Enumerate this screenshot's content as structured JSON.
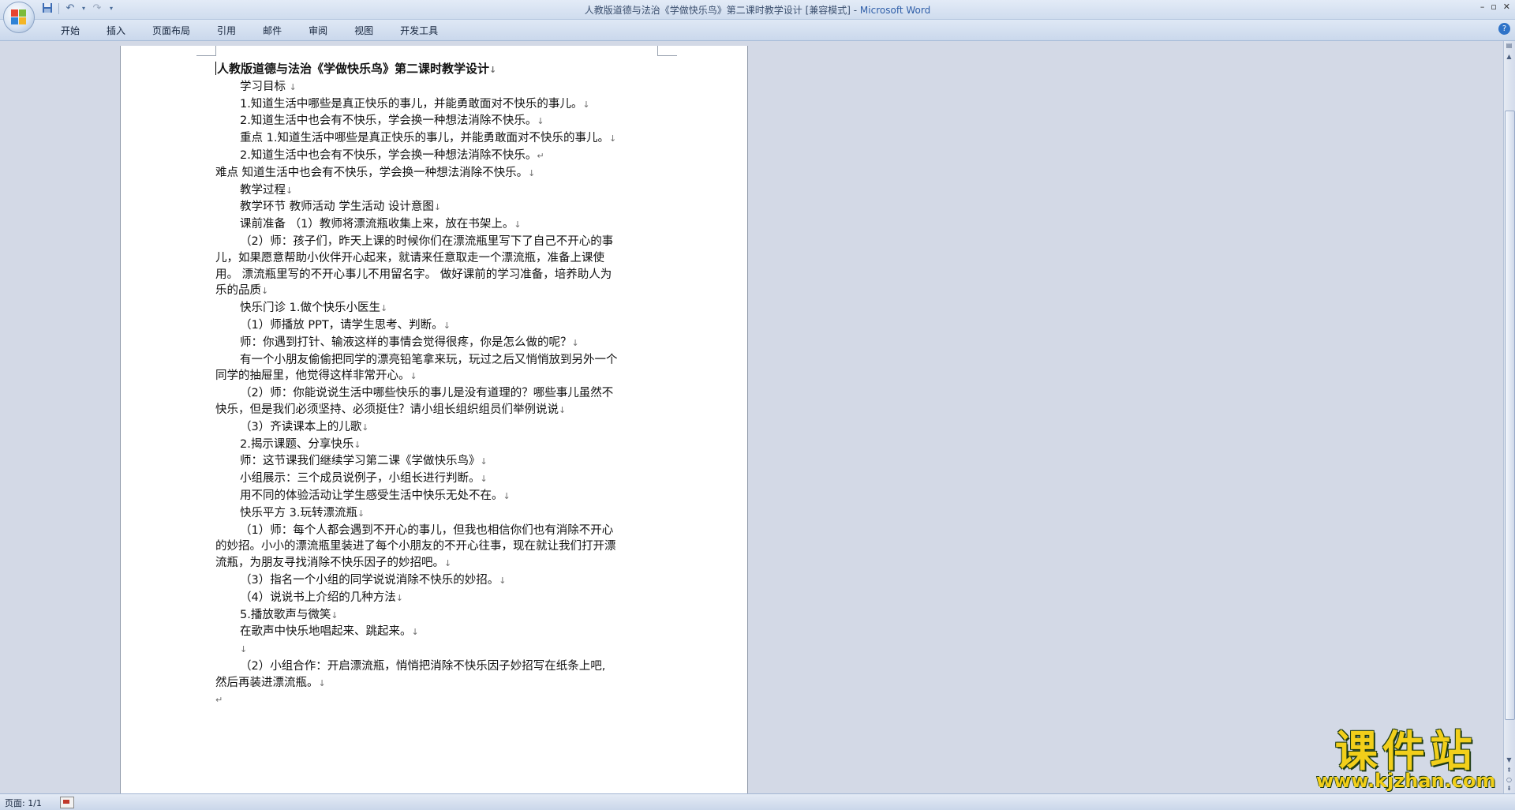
{
  "window": {
    "doc_name": "人教版道德与法治《学做快乐鸟》第二课时教学设计 [兼容模式] - ",
    "app_name": "Microsoft Word"
  },
  "ribbon": {
    "tabs": [
      "开始",
      "插入",
      "页面布局",
      "引用",
      "邮件",
      "审阅",
      "视图",
      "开发工具"
    ]
  },
  "document": {
    "title": "人教版道德与法治《学做快乐鸟》第二课时教学设计",
    "lines": [
      {
        "text": "学习目标 ",
        "indent": true
      },
      {
        "text": "1.知道生活中哪些是真正快乐的事儿，并能勇敢面对不快乐的事儿。",
        "indent": true
      },
      {
        "text": "2.知道生活中也会有不快乐，学会换一种想法消除不快乐。",
        "indent": true
      },
      {
        "text": "重点 1.知道生活中哪些是真正快乐的事儿，并能勇敢面对不快乐的事儿。",
        "indent": true
      },
      {
        "text": "2.知道生活中也会有不快乐，学会换一种想法消除不快乐。",
        "indent": true,
        "mark": "↵"
      },
      {
        "text": "难点 知道生活中也会有不快乐，学会换一种想法消除不快乐。",
        "indent": false
      },
      {
        "text": "教学过程",
        "indent": true
      },
      {
        "text": "教学环节 教师活动 学生活动 设计意图",
        "indent": true
      },
      {
        "text": "课前准备 （1）教师将漂流瓶收集上来，放在书架上。",
        "indent": true
      },
      {
        "text": "（2）师：孩子们，昨天上课的时候你们在漂流瓶里写下了自己不开心的事",
        "indent": true,
        "nomark": true
      },
      {
        "text": "儿，如果愿意帮助小伙伴开心起来，就请来任意取走一个漂流瓶，准备上课使",
        "indent": false,
        "nomark": true
      },
      {
        "text": "用。 漂流瓶里写的不开心事儿不用留名字。 做好课前的学习准备，培养助人为",
        "indent": false,
        "nomark": true
      },
      {
        "text": "乐的品质",
        "indent": false
      },
      {
        "text": "快乐门诊 1.做个快乐小医生",
        "indent": true
      },
      {
        "text": "（1）师播放 PPT，请学生思考、判断。",
        "indent": true
      },
      {
        "text": "师：你遇到打针、输液这样的事情会觉得很疼，你是怎么做的呢？",
        "indent": true
      },
      {
        "text": "有一个小朋友偷偷把同学的漂亮铅笔拿来玩，玩过之后又悄悄放到另外一个",
        "indent": true,
        "nomark": true
      },
      {
        "text": "同学的抽屉里，他觉得这样非常开心。",
        "indent": false
      },
      {
        "text": "（2）师：你能说说生活中哪些快乐的事儿是没有道理的？哪些事儿虽然不",
        "indent": true,
        "nomark": true
      },
      {
        "text": "快乐，但是我们必须坚持、必须挺住？请小组长组织组员们举例说说",
        "indent": false
      },
      {
        "text": "（3）齐读课本上的儿歌",
        "indent": true
      },
      {
        "text": "2.揭示课题、分享快乐",
        "indent": true
      },
      {
        "text": "师：这节课我们继续学习第二课《学做快乐鸟》",
        "indent": true
      },
      {
        "text": "小组展示：三个成员说例子，小组长进行判断。",
        "indent": true
      },
      {
        "text": " 用不同的体验活动让学生感受生活中快乐无处不在。",
        "indent": true
      },
      {
        "text": "快乐平方 3.玩转漂流瓶",
        "indent": true
      },
      {
        "text": "（1）师：每个人都会遇到不开心的事儿，但我也相信你们也有消除不开心",
        "indent": true,
        "nomark": true
      },
      {
        "text": "的妙招。小小的漂流瓶里装进了每个小朋友的不开心往事，现在就让我们打开漂",
        "indent": false,
        "nomark": true
      },
      {
        "text": "流瓶，为朋友寻找消除不快乐因子的妙招吧。",
        "indent": false
      },
      {
        "text": "（3）指名一个小组的同学说说消除不快乐的妙招。",
        "indent": true
      },
      {
        "text": "（4）说说书上介绍的几种方法",
        "indent": true
      },
      {
        "text": "5.播放歌声与微笑",
        "indent": true
      },
      {
        "text": "在歌声中快乐地唱起来、跳起来。",
        "indent": true
      },
      {
        "text": " ",
        "indent": true
      },
      {
        "text": "（2）小组合作：开启漂流瓶，悄悄把消除不快乐因子妙招写在纸条上吧,",
        "indent": true,
        "nomark": true
      },
      {
        "text": "然后再装进漂流瓶。",
        "indent": false
      },
      {
        "text": "",
        "indent": false,
        "mark": "↵"
      }
    ]
  },
  "statusbar": {
    "page": "页面: 1/1"
  },
  "watermark": {
    "cn": "课件站",
    "url": "www.kjzhan.com"
  },
  "colors": {
    "workspace": "#d3d9e6",
    "ribbon": "#cad8ec",
    "watermark": "#f2cf1a"
  }
}
